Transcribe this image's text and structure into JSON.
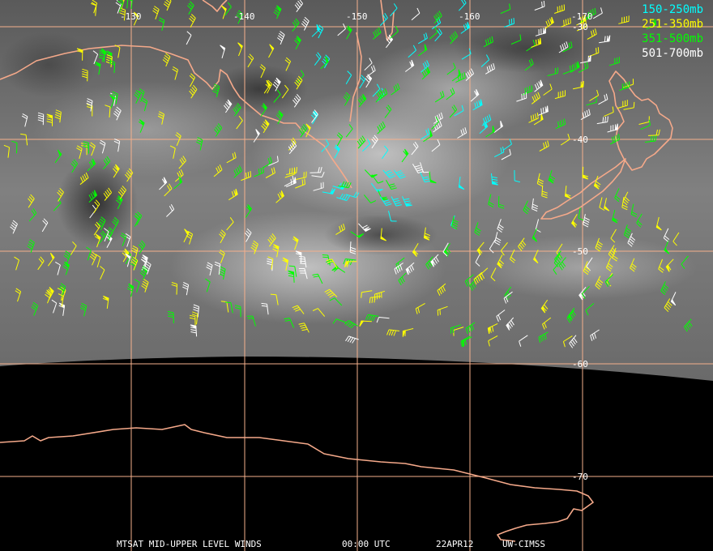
{
  "legend": {
    "levels": [
      {
        "label": "150-250mb",
        "color": "#00ffff"
      },
      {
        "label": "251-350mb",
        "color": "#ffff00"
      },
      {
        "label": "351-500mb",
        "color": "#00ff00"
      },
      {
        "label": "501-700mb",
        "color": "#ffffff"
      }
    ]
  },
  "grid": {
    "color": "#f5b08c",
    "longitude_labels": [
      "-130",
      "-140",
      "-150",
      "-160",
      "-170"
    ],
    "latitude_labels": [
      "-30",
      "-40",
      "-50",
      "-60",
      "-70"
    ]
  },
  "caption": {
    "product": "MTSAT MID-UPPER LEVEL WINDS",
    "time": "00:00 UTC",
    "date": "22APR12",
    "source": "UW-CIMSS"
  },
  "colors": {
    "coastline": "#f5a98a",
    "no_data": "#000000",
    "imagery_gray": "#7a7a7a"
  }
}
